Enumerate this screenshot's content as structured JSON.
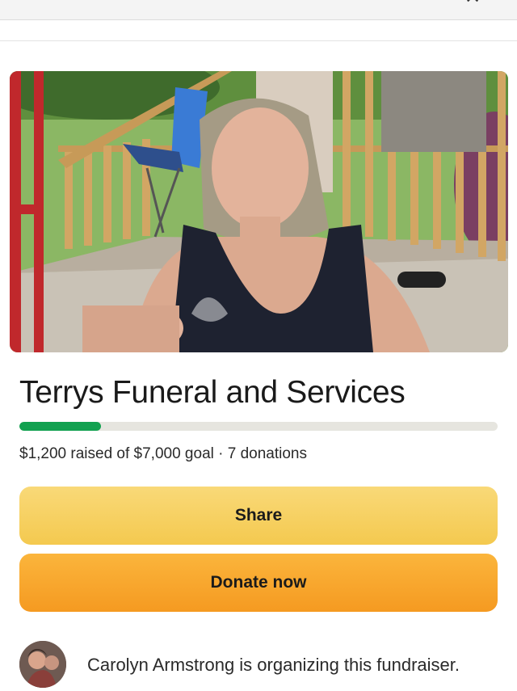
{
  "header": {
    "close_icon": "close-icon"
  },
  "campaign": {
    "title": "Terrys Funeral and Services",
    "raised": "$1,200",
    "goal": "$7,000",
    "donations": "7 donations",
    "stats_text": "$1,200 raised of $7,000 goal · 7 donations",
    "progress_fraction": 0.1714
  },
  "actions": {
    "share_label": "Share",
    "donate_label": "Donate now"
  },
  "organizer": {
    "text": "Carolyn Armstrong is organizing this fundraiser."
  },
  "colors": {
    "progress": "#12a150",
    "share_button": "#f4c94f",
    "donate_button": "#f59a21"
  }
}
